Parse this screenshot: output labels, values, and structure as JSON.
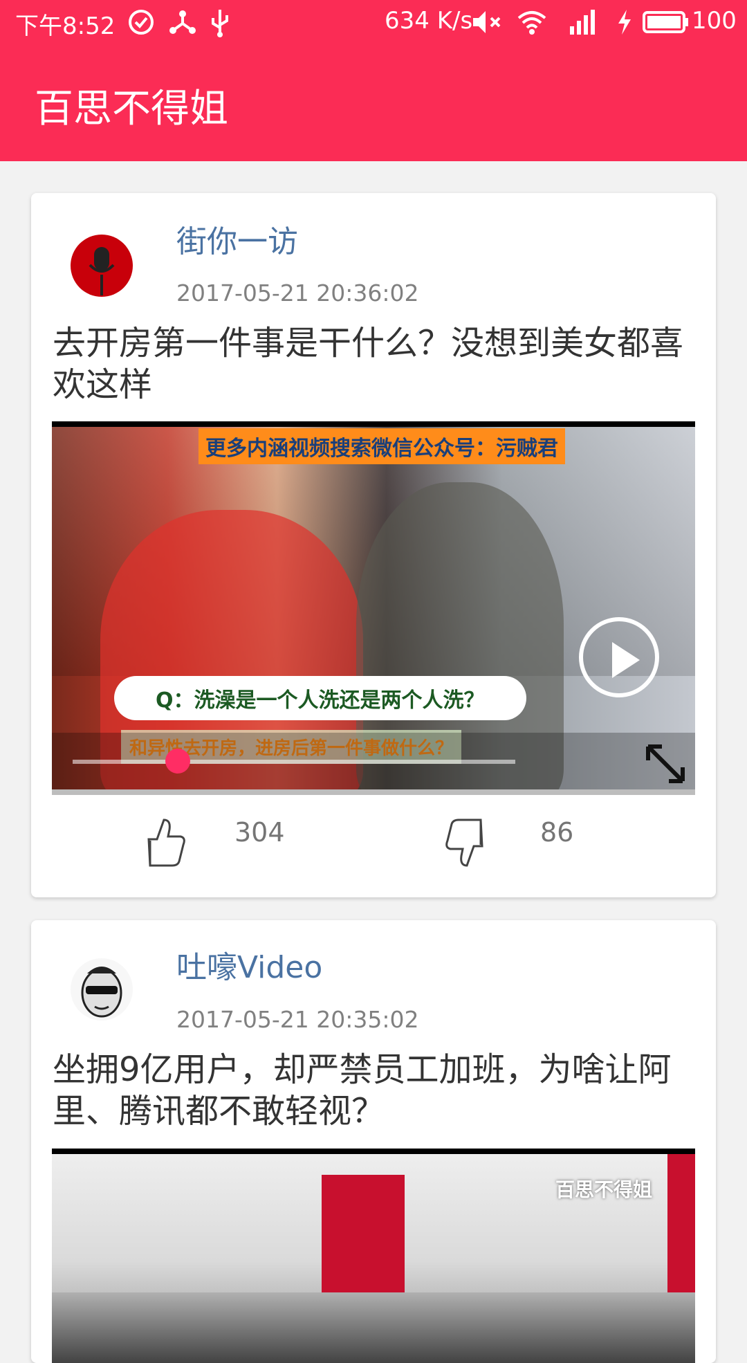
{
  "status_bar": {
    "time": "下午8:52",
    "net_speed": "634 K/s",
    "battery": "100"
  },
  "app_bar": {
    "title": "百思不得姐"
  },
  "colors": {
    "brand": "#fb2c55",
    "author": "#4a72a2",
    "accent": "#ff2d64"
  },
  "posts": [
    {
      "author": "街你一访",
      "time": "2017-05-21 20:36:02",
      "title": "去开房第一件事是干什么？没想到美女都喜欢这样",
      "video": {
        "banner": "更多内涵视频搜索微信公众号：污贼君",
        "subtitle": "Q：洗澡是一个人洗还是两个人洗？",
        "caption": "和异性去开房，进房后第一件事做什么？"
      },
      "likes": "304",
      "dislikes": "86"
    },
    {
      "author": "吐嚎Video",
      "time": "2017-05-21 20:35:02",
      "title": "坐拥9亿用户，却严禁员工加班，为啥让阿里、腾讯都不敢轻视？",
      "video": {
        "watermark": "百思不得姐"
      }
    }
  ]
}
